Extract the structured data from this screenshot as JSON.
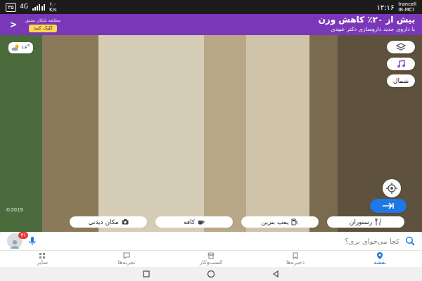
{
  "status_bar": {
    "carrier": "Irancell",
    "carrier_sub": "IR-MCI",
    "time": "۱۲:۱۶",
    "speed": "۶.۰",
    "speed_unit": "K/s",
    "network": "4G",
    "battery": "۳۵"
  },
  "ad": {
    "title": "بیش از ۲۰٪ کاهش وزن",
    "subtitle": "با داروی جدید داروسازی دکتر عبیدی",
    "label": "مطابقه بایکان نشنق",
    "button": "کلیک کنید",
    "arrow": "<"
  },
  "map": {
    "weather": "۱۶°",
    "compass": "شمال",
    "attribution": "©2019"
  },
  "categories": [
    {
      "label": "رستوران",
      "kind": "restaurant"
    },
    {
      "label": "پمپ بنزین",
      "kind": "fuel"
    },
    {
      "label": "کافه",
      "kind": "cafe"
    },
    {
      "label": "مکان دیدنی",
      "kind": "sight"
    }
  ],
  "search": {
    "placeholder": "کجا می‌خوای بری؟",
    "badge": "۳۱"
  },
  "nav": [
    {
      "label": "نقشه",
      "selected": true
    },
    {
      "label": "ذخیره‌ها",
      "selected": false
    },
    {
      "label": "کسب‌وکار",
      "selected": false
    },
    {
      "label": "تجربه‌ها",
      "selected": false
    },
    {
      "label": "سایر",
      "selected": false
    }
  ]
}
